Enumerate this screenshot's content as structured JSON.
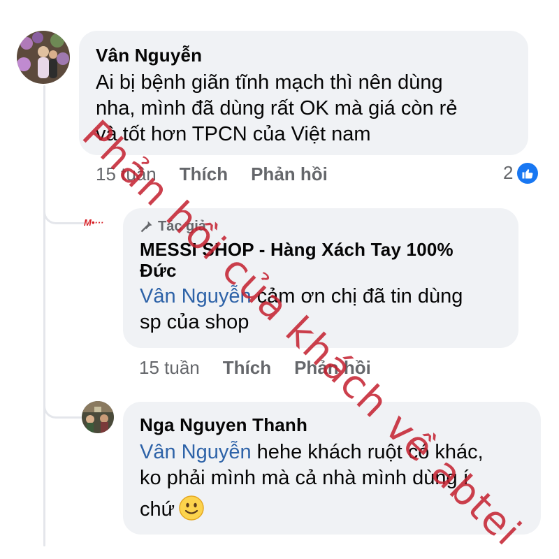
{
  "comments": [
    {
      "author": "Vân Nguyễn",
      "lines": [
        "Ai bị bệnh giãn tĩnh mạch thì nên dùng",
        "nha, mình đã dùng rất OK mà  giá  còn rẻ",
        "và tốt hơn TPCN của Việt nam"
      ],
      "time": "15 tuần",
      "like_label": "Thích",
      "reply_label": "Phản hồi",
      "reaction_count": "2"
    },
    {
      "badge": "Tác giả",
      "author_lines": [
        "MESSI SHOP - Hàng Xách Tay 100%",
        "Đức"
      ],
      "mention": "Vân Nguyễn",
      "line1_rest": " cảm ơn chị đã tin dùng",
      "line2": "sp của shop",
      "time": "15 tuần",
      "like_label": "Thích",
      "reply_label": "Phản hồi"
    },
    {
      "author": "Nga Nguyen Thanh",
      "mention": "Vân Nguyễn",
      "line1_rest": " hehe khách ruột có khác,",
      "line2": "ko phải mình mà cả nhà mình dùng í",
      "line3": "chứ"
    }
  ],
  "shop_logo_text": "M•···",
  "watermark": "Phản hồi của khách về abtei",
  "colors": {
    "bubble": "#f0f2f5",
    "mention": "#2e63a8",
    "like": "#1877f2",
    "watermark": "#c41f2e"
  }
}
